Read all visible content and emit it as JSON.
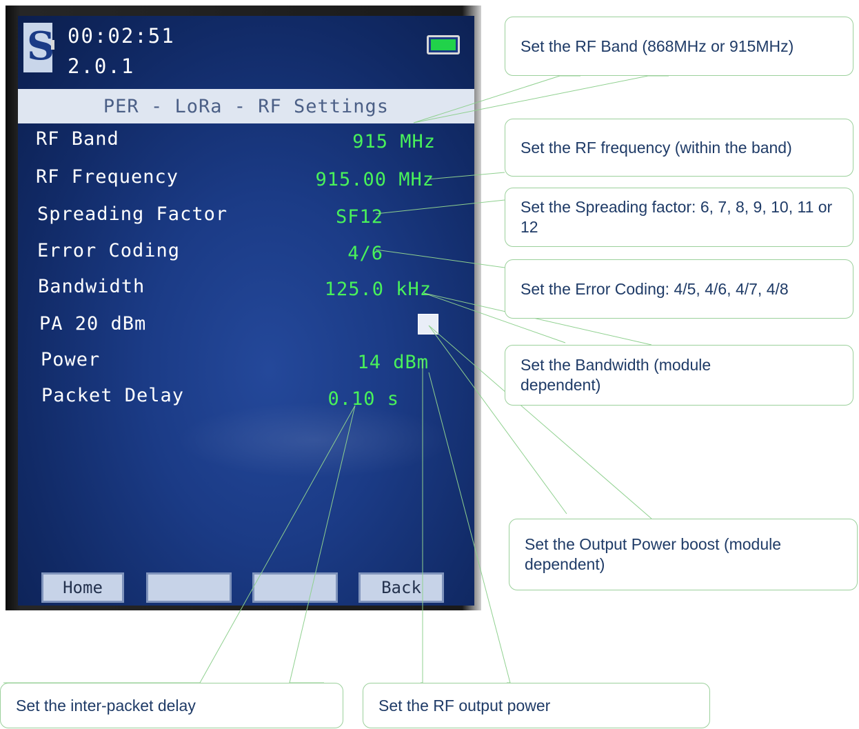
{
  "device": {
    "time": "00:02:51",
    "version": "2.0.1",
    "screen_title": "PER - LoRa - RF Settings",
    "colors": {
      "screen_bg": "#1b3b86",
      "value_text": "#49f25a",
      "label_text": "#ffffff",
      "battery": "#21d24a"
    },
    "logo_icon": "company-logo-icon",
    "settings": [
      {
        "label": "RF Band",
        "value": "915 MHz"
      },
      {
        "label": "RF Frequency",
        "value": "915.00 MHz"
      },
      {
        "label": "Spreading Factor",
        "value": "SF12"
      },
      {
        "label": "Error Coding",
        "value": "4/6"
      },
      {
        "label": "Bandwidth",
        "value": "125.0 kHz"
      },
      {
        "label": "PA 20 dBm",
        "value": "",
        "control": "checkbox",
        "checked": false
      },
      {
        "label": "Power",
        "value": "14 dBm"
      },
      {
        "label": "Packet Delay",
        "value": "0.10 s"
      }
    ],
    "softkeys": [
      "Home",
      "",
      "",
      "Back"
    ]
  },
  "callouts": {
    "rf_band": "Set the RF Band (868MHz or 915MHz)",
    "rf_frequency": "Set the RF frequency (within the band)",
    "spreading_factor": "Set the Spreading factor: 6, 7, 8, 9, 10, 11 or 12",
    "error_coding": "Set the Error Coding: 4/5, 4/6, 4/7, 4/8",
    "bandwidth": "Set the Bandwidth (module dependent)",
    "output_boost": "Set the Output Power boost (module dependent)",
    "packet_delay": "Set the inter-packet delay",
    "output_power": "Set the RF output power"
  }
}
